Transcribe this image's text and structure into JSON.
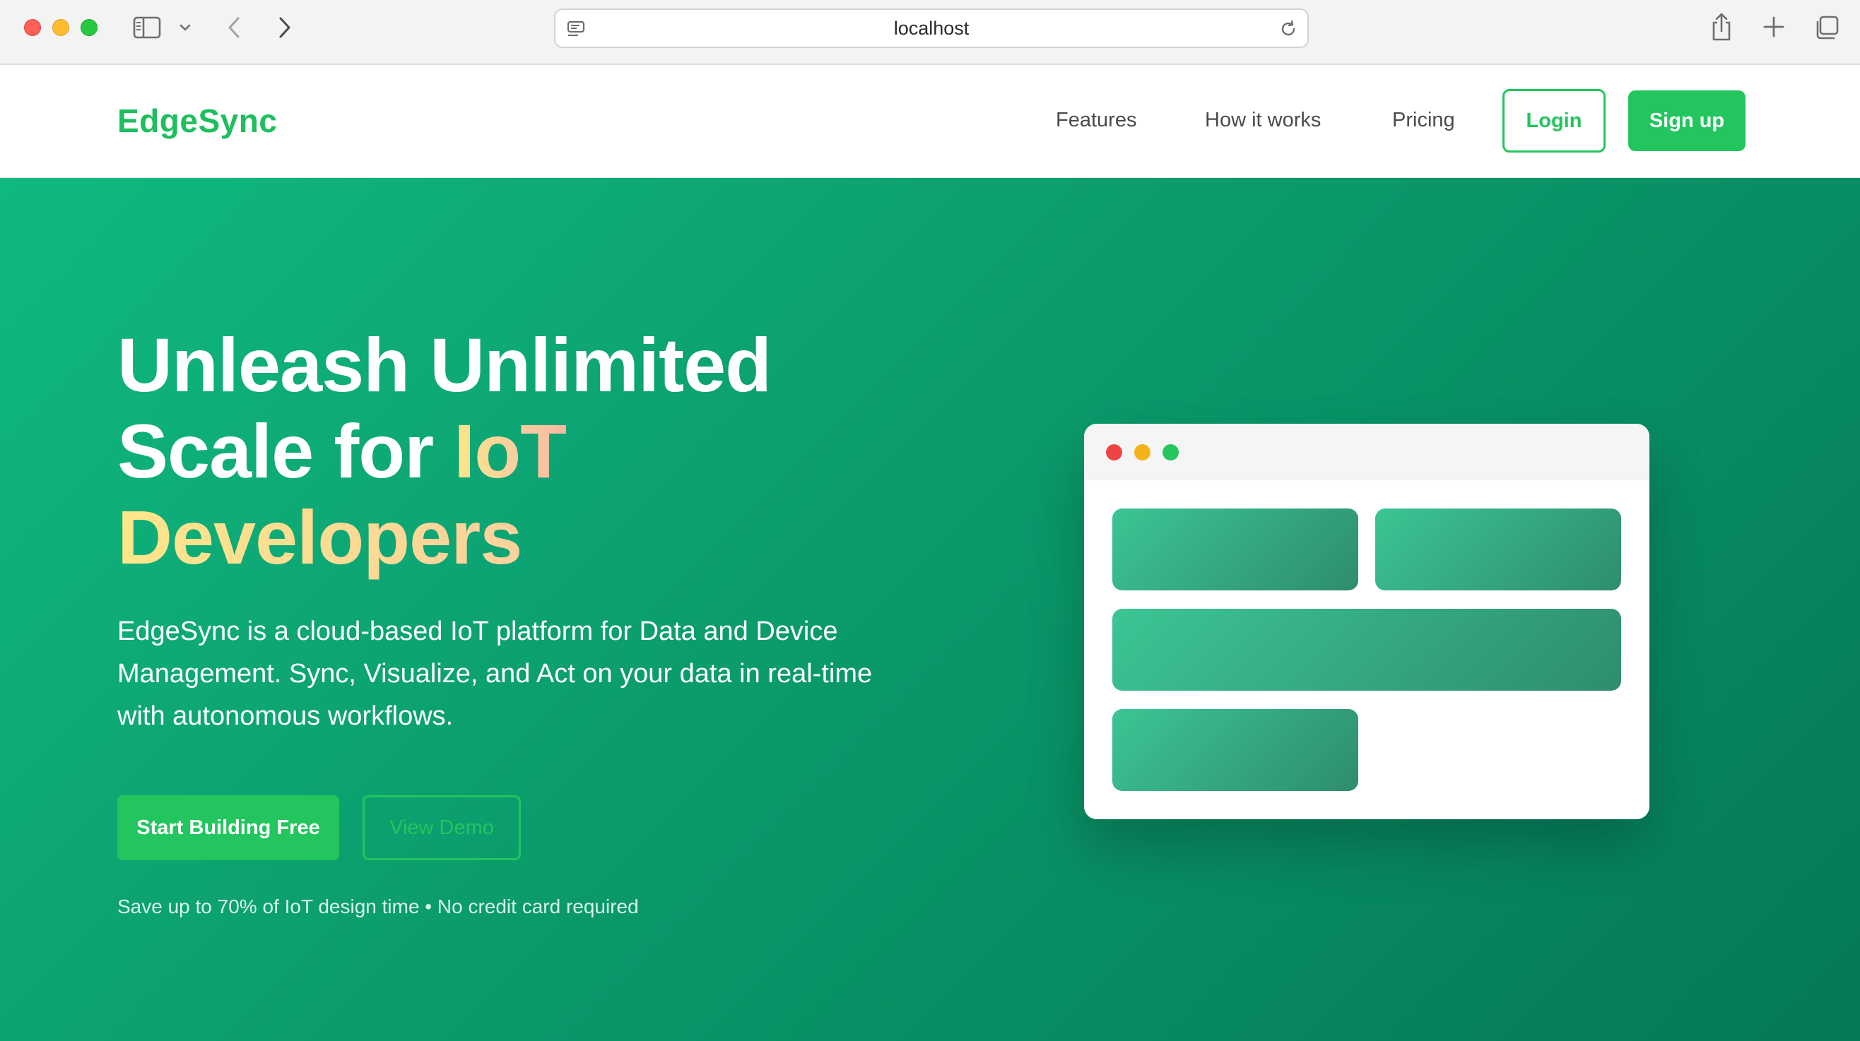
{
  "browser": {
    "url": "localhost",
    "icons": [
      "sidebar-icon",
      "chevron-down-icon",
      "back-icon",
      "forward-icon",
      "site-settings-icon",
      "reload-icon",
      "share-icon",
      "new-tab-icon",
      "tab-overview-icon"
    ]
  },
  "nav": {
    "logo": "EdgeSync",
    "links": [
      "Features",
      "How it works",
      "Pricing"
    ],
    "login_label": "Login",
    "signup_label": "Sign up"
  },
  "hero": {
    "title_line1": "Unleash Unlimited",
    "title_line2_plain": "Scale for ",
    "title_line2_accent": "IoT",
    "title_line3_accent": "Developers",
    "description": "EdgeSync is a cloud-based IoT platform for Data and Device Management. Sync, Visualize, and Act on your data in real-time with autonomous workflows.",
    "primary_cta": "Start Building Free",
    "secondary_cta": "View Demo",
    "note": "Save up to 70% of IoT design time • No credit card required"
  },
  "colors": {
    "brand": "#1fbe5e",
    "button": "#22c55e",
    "hero_start": "#10b981",
    "hero_end": "#047857",
    "accent_start": "#fde68a",
    "accent_end": "#f9b8a0"
  }
}
